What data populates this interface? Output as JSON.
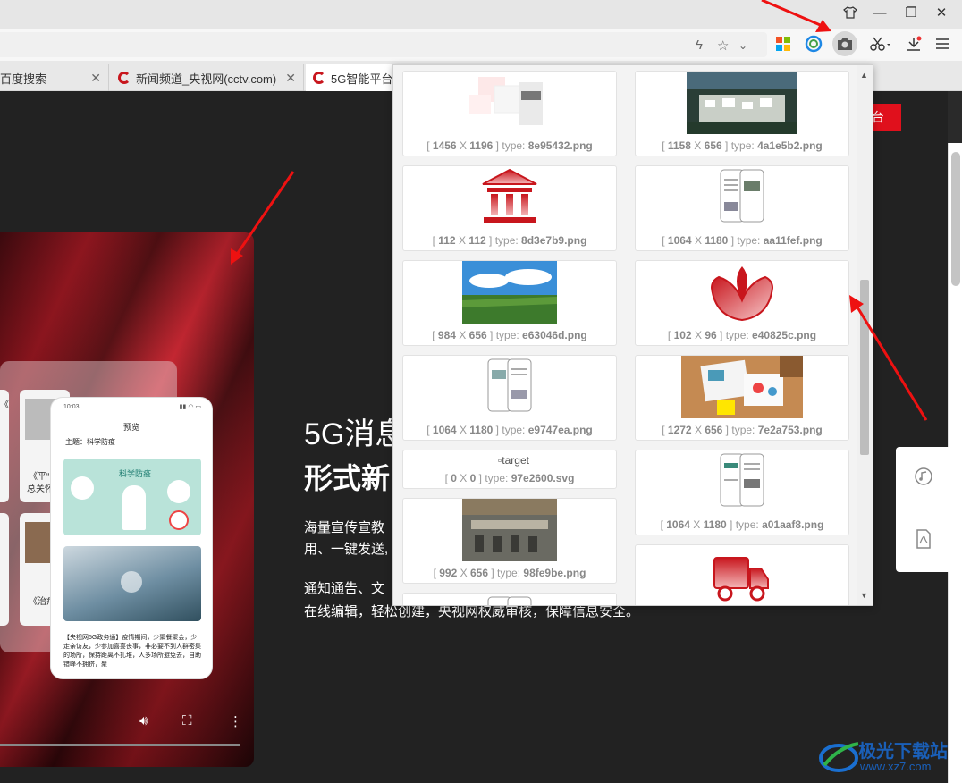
{
  "window": {
    "restore_icon": "tshirt-icon",
    "minimize": "—",
    "maximize": "❐",
    "close": "✕"
  },
  "toolbar": {
    "icons": [
      "lightning-icon",
      "star-icon",
      "chevron-down-icon",
      "apps-grid-icon",
      "circle-app-icon",
      "camera-icon",
      "scissors-icon",
      "download-icon",
      "menu-icon"
    ]
  },
  "tabs": [
    {
      "label": "百度搜索",
      "active": false
    },
    {
      "label": "新闻频道_央视网(cctv.com)",
      "active": false
    },
    {
      "label": "5G智能平台_",
      "active": true
    }
  ],
  "page": {
    "red_button": "台",
    "heading_line1": "5G消息",
    "heading_line2": "形式新",
    "para1_line1": "海量宣传宣教",
    "para1_line2": "用、一键发送,",
    "para2_line1": "通知通告、文",
    "para2_line2": "在线编辑，轻松创建，央视网权威审核，保障信息安全。",
    "mini_text_1": "《平“",
    "mini_text_2": "总关怀",
    "mini_text_3": "《治疗",
    "mini_text_4": "《",
    "phone": {
      "status": "10:03",
      "title": "预览",
      "topic": "主题：科学防疫",
      "img_title": "科学防疫",
      "caption": "【央视网5G政务通】疫情期间，少聚餐聚会，少走亲访友，少参加喜宴丧事，非必要不到人群密集的场所，保持距离不扎堆，人多场所避免去，自助错峰不拥挤，聚"
    }
  },
  "popup": {
    "images": [
      {
        "width": "1456",
        "height": "1196",
        "type": "8e95432.png",
        "kind": "ui-screens"
      },
      {
        "width": "1158",
        "height": "656",
        "type": "4a1e5b2.png",
        "kind": "village-photo"
      },
      {
        "width": "112",
        "height": "112",
        "type": "8d3e7b9.png",
        "kind": "building-icon"
      },
      {
        "width": "1064",
        "height": "1180",
        "type": "aa11fef.png",
        "kind": "phones"
      },
      {
        "width": "984",
        "height": "656",
        "type": "e63046d.png",
        "kind": "field-photo"
      },
      {
        "width": "102",
        "height": "96",
        "type": "e40825c.png",
        "kind": "leaf-icon"
      },
      {
        "width": "1064",
        "height": "1180",
        "type": "e9747ea.png",
        "kind": "phones"
      },
      {
        "width": "1272",
        "height": "656",
        "type": "7e2a753.png",
        "kind": "desk-photo"
      },
      {
        "width": "0",
        "height": "0",
        "type": "97e2600.svg",
        "kind": "broken",
        "alt": "target"
      },
      {
        "width": "1064",
        "height": "1180",
        "type": "a01aaf8.png",
        "kind": "phones"
      },
      {
        "width": "992",
        "height": "656",
        "type": "98fe9be.png",
        "kind": "aerial-photo"
      },
      {
        "width": "",
        "height": "",
        "type": "",
        "kind": "truck-icon"
      }
    ],
    "type_label": "type:",
    "x_sep": "X"
  },
  "watermark": {
    "brand": "极光下载站",
    "url": "www.xz7.com"
  },
  "colors": {
    "accent": "#e0101c",
    "arrow": "#ee1111"
  }
}
